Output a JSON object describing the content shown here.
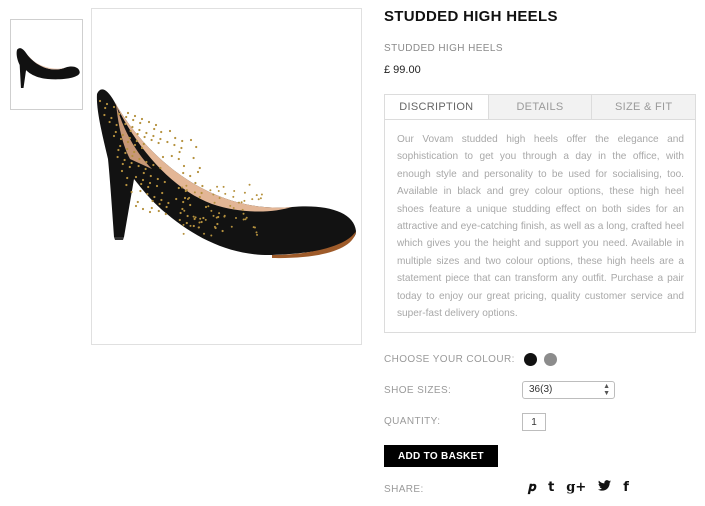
{
  "product": {
    "title": "STUDDED HIGH HEELS",
    "subtitle": "STUDDED HIGH HEELS",
    "price": "£ 99.00"
  },
  "tabs": [
    {
      "label": "DISCRIPTION",
      "active": true
    },
    {
      "label": "DETAILS",
      "active": false
    },
    {
      "label": "SIZE & FIT",
      "active": false
    }
  ],
  "description": "Our Vovam studded high heels offer the elegance and sophistication to get you through a day in the office, with enough style and personality to be used for socialising, too. Available in black and grey colour options, these high heel shoes feature a unique studding effect on both sides for an attractive and eye-catching finish, as well as a long, crafted heel which gives you the height and support you need. Available in multiple sizes and two colour options, these high heels are a statement piece that can transform any outfit. Purchase a pair today to enjoy our great pricing, quality customer service and super-fast delivery options.",
  "colour": {
    "label": "CHOOSE YOUR COLOUR:",
    "options": [
      "#111111",
      "#8c8c8c"
    ]
  },
  "sizes": {
    "label": "SHOE SIZES:",
    "selected": "36(3)"
  },
  "quantity": {
    "label": "QUANTITY:",
    "value": "1"
  },
  "basket_button": "ADD TO BASKET",
  "share": {
    "label": "SHARE:",
    "icons": [
      {
        "name": "pinterest-icon",
        "glyph": "P"
      },
      {
        "name": "tumblr-icon",
        "glyph": "t"
      },
      {
        "name": "google-plus-icon",
        "glyph": "g+"
      },
      {
        "name": "twitter-icon",
        "glyph": "🐦"
      },
      {
        "name": "facebook-icon",
        "glyph": "f"
      }
    ]
  }
}
